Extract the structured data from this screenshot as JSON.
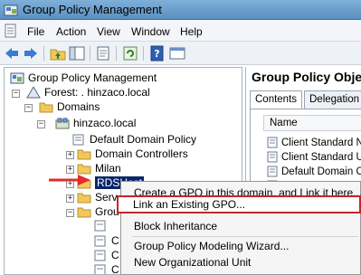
{
  "window": {
    "title": "Group Policy Management"
  },
  "menu": {
    "items": [
      "File",
      "Action",
      "View",
      "Window",
      "Help"
    ]
  },
  "icons": {
    "app": "group-policy-icon",
    "doc": "document-icon",
    "back": "back-arrow-icon",
    "forward": "forward-arrow-icon",
    "up": "up-folder-icon",
    "show_tree": "show-tree-icon",
    "properties": "properties-icon",
    "refresh": "refresh-icon",
    "help": "help-icon",
    "console": "console-icon"
  },
  "tree": {
    "root": "Group Policy Management",
    "forest": "Forest: . hinzaco.local",
    "domains": "Domains",
    "domain": "hinzaco.local",
    "items": [
      "Default Domain Policy",
      "Domain Controllers",
      "Milan",
      "RDSHost",
      "Serv",
      "Grou"
    ],
    "sub_items": [
      "",
      "C",
      "C",
      "C",
      "C",
      "C"
    ]
  },
  "right_pane": {
    "title": "Group Policy Obje",
    "tabs": [
      "Contents",
      "Delegation"
    ],
    "column": "Name",
    "rows": [
      "Client Standard Ne",
      "Client Standard Us",
      "Default Domain Co",
      "",
      "",
      "",
      "",
      ""
    ]
  },
  "context_menu": {
    "items": [
      "Create a GPO in this domain, and Link it here...",
      "Link an Existing GPO...",
      "Block Inheritance",
      "Group Policy Modeling Wizard...",
      "New Organizational Unit"
    ]
  },
  "colors": {
    "selection": "#0a246a",
    "highlight_border": "#c1272d",
    "arrow": "#e32b2b",
    "folder": "#f1c85a"
  }
}
